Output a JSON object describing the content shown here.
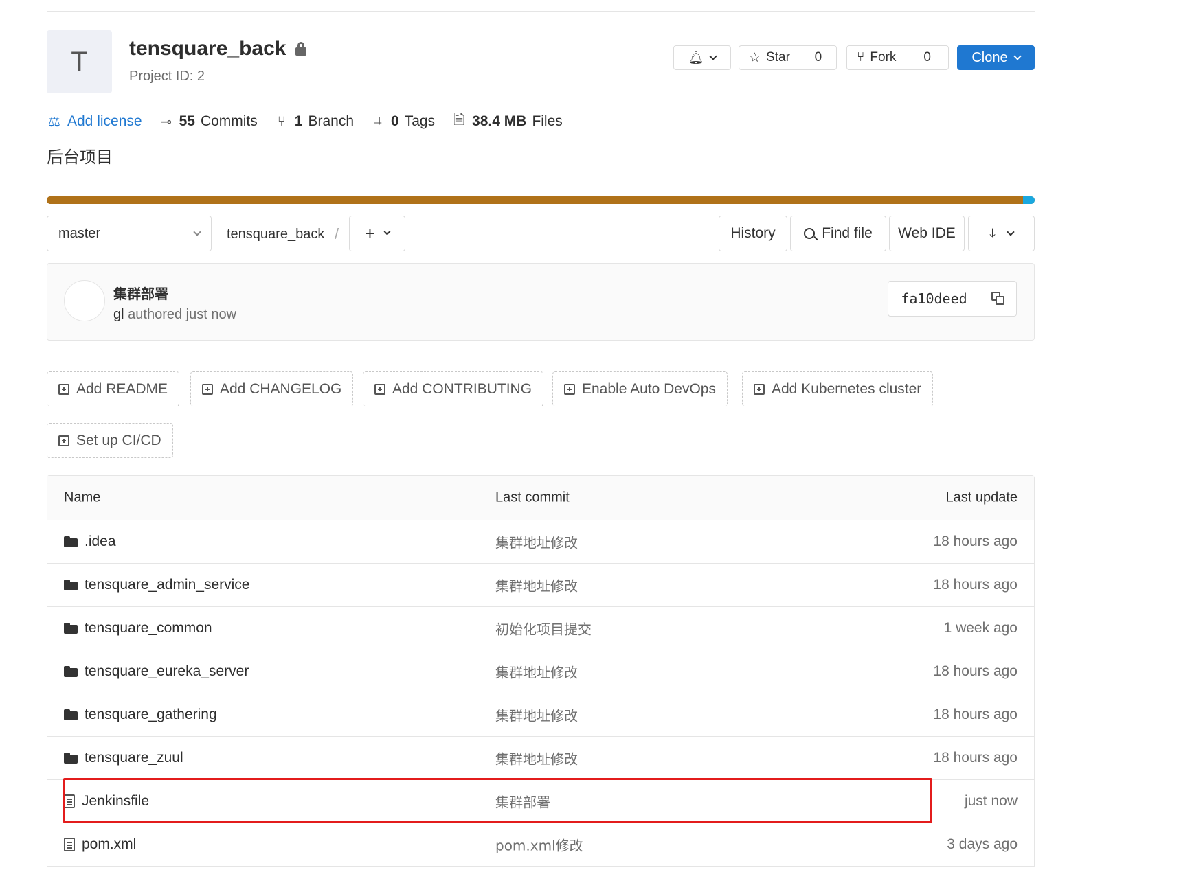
{
  "project": {
    "avatar_letter": "T",
    "name": "tensquare_back",
    "id_text": "Project ID: 2",
    "description": "后台项目"
  },
  "header_actions": {
    "star_label": "Star",
    "star_count": "0",
    "fork_label": "Fork",
    "fork_count": "0",
    "clone_label": "Clone"
  },
  "stats": {
    "license_label": "Add license",
    "commits_count": "55",
    "commits_label": "Commits",
    "branch_count": "1",
    "branch_label": "Branch",
    "tags_count": "0",
    "tags_label": "Tags",
    "files_size": "38.4 MB",
    "files_label": "Files"
  },
  "language_bar": {
    "primary_color": "#b07219",
    "secondary_color": "#1aa8e0",
    "primary_fraction": 0.988
  },
  "toolbar": {
    "branch": "master",
    "breadcrumb": "tensquare_back",
    "separator": "/",
    "history": "History",
    "find_file": "Find file",
    "web_ide": "Web IDE"
  },
  "last_commit": {
    "title": "集群部署",
    "author": "gl",
    "meta": "authored just now",
    "sha": "fa10deed"
  },
  "suggestions": [
    "Add README",
    "Add CHANGELOG",
    "Add CONTRIBUTING",
    "Enable Auto DevOps",
    "Add Kubernetes cluster",
    "Set up CI/CD"
  ],
  "table": {
    "headers": {
      "name": "Name",
      "commit": "Last commit",
      "update": "Last update"
    },
    "rows": [
      {
        "type": "folder",
        "name": ".idea",
        "commit": "集群地址修改",
        "update": "18 hours ago"
      },
      {
        "type": "folder",
        "name": "tensquare_admin_service",
        "commit": "集群地址修改",
        "update": "18 hours ago"
      },
      {
        "type": "folder",
        "name": "tensquare_common",
        "commit": "初始化项目提交",
        "update": "1 week ago"
      },
      {
        "type": "folder",
        "name": "tensquare_eureka_server",
        "commit": "集群地址修改",
        "update": "18 hours ago"
      },
      {
        "type": "folder",
        "name": "tensquare_gathering",
        "commit": "集群地址修改",
        "update": "18 hours ago"
      },
      {
        "type": "folder",
        "name": "tensquare_zuul",
        "commit": "集群地址修改",
        "update": "18 hours ago"
      },
      {
        "type": "file",
        "name": "Jenkinsfile",
        "commit": "集群部署",
        "update": "just now"
      },
      {
        "type": "file",
        "name": "pom.xml",
        "commit": "pom.xml修改",
        "update": "3 days ago"
      }
    ]
  },
  "colors": {
    "accent": "#1f78d1",
    "highlight_border": "#e31c1c"
  }
}
